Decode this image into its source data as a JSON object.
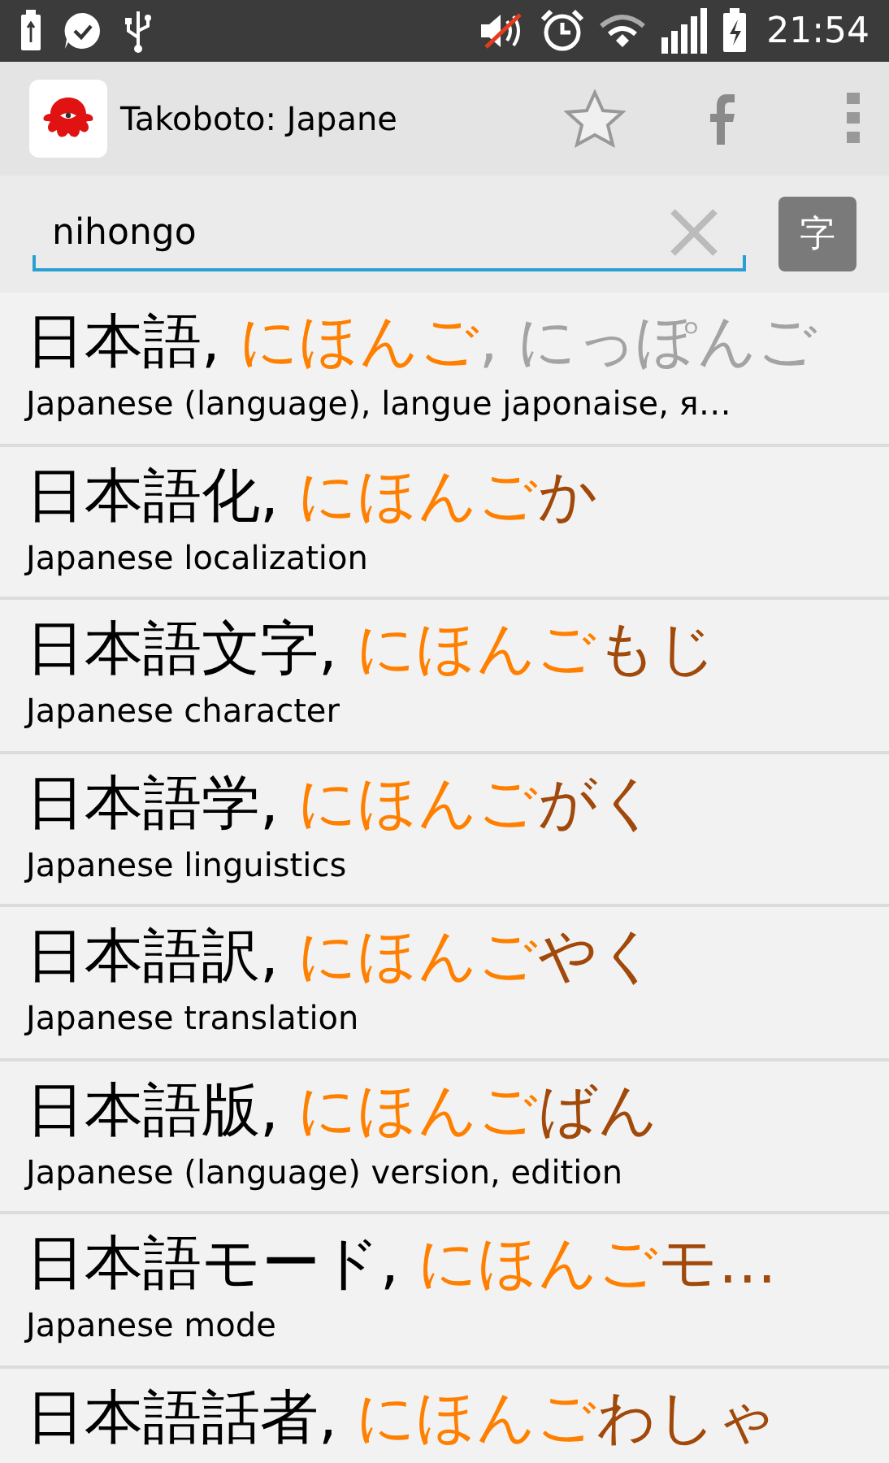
{
  "status_bar": {
    "time": "21:54"
  },
  "toolbar": {
    "title": "Takoboto: Japane"
  },
  "search": {
    "value": "nihongo",
    "kanji_button": "字"
  },
  "results": [
    {
      "word": "日本語,",
      "reading_match": "にほんご",
      "alternate": ", にっぽんご",
      "meaning": "Japanese (language), langue japonaise, я…"
    },
    {
      "word": "日本語化,",
      "reading_match": "にほんご",
      "reading_rest": "か",
      "meaning": "Japanese localization"
    },
    {
      "word": "日本語文字,",
      "reading_match": "にほんご",
      "reading_rest": "もじ",
      "meaning": "Japanese character"
    },
    {
      "word": "日本語学,",
      "reading_match": "にほんご",
      "reading_rest": "がく",
      "meaning": "Japanese linguistics"
    },
    {
      "word": "日本語訳,",
      "reading_match": "にほんご",
      "reading_rest": "やく",
      "meaning": "Japanese translation"
    },
    {
      "word": "日本語版,",
      "reading_match": "にほんご",
      "reading_rest": "ばん",
      "meaning": "Japanese (language) version, edition"
    },
    {
      "word": "日本語モード,",
      "reading_match": "にほんご",
      "reading_rest": "モ…",
      "meaning": "Japanese mode"
    },
    {
      "word": "日本語話者,",
      "reading_match": "にほんご",
      "reading_rest": "わしゃ"
    }
  ]
}
